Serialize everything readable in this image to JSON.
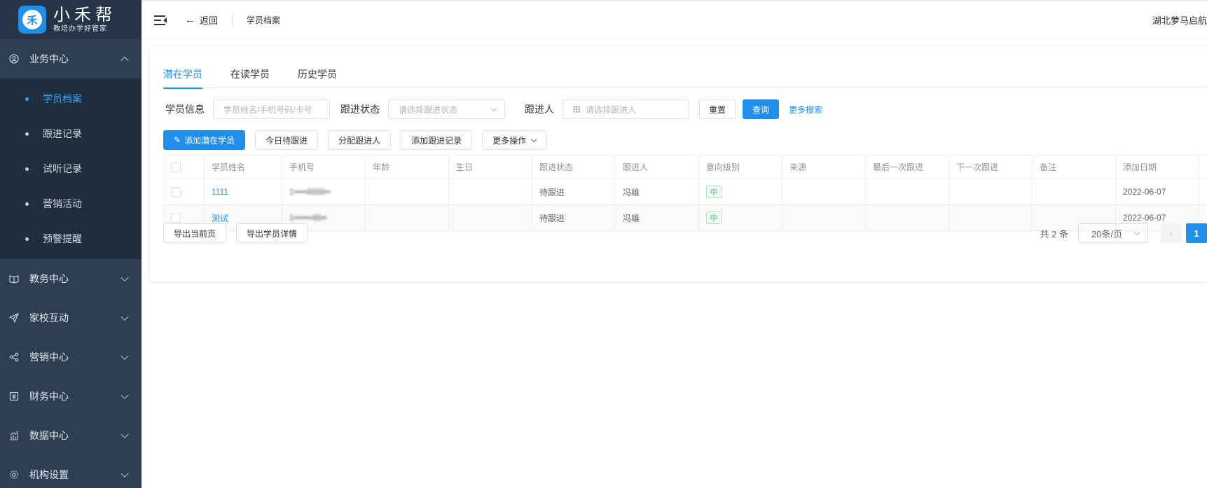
{
  "logo": {
    "main": "小禾帮",
    "sub": "教培办学好管家",
    "badge": "禾"
  },
  "sidebar": {
    "groups": [
      {
        "label": "业务中心",
        "icon": "user-circle-icon",
        "expanded": true,
        "items": [
          {
            "label": "学员档案",
            "active": true
          },
          {
            "label": "跟进记录"
          },
          {
            "label": "试听记录"
          },
          {
            "label": "营销活动"
          },
          {
            "label": "预警提醒"
          }
        ]
      },
      {
        "label": "教务中心",
        "icon": "book-icon"
      },
      {
        "label": "家校互动",
        "icon": "paper-plane-icon"
      },
      {
        "label": "营销中心",
        "icon": "share-icon"
      },
      {
        "label": "财务中心",
        "icon": "finance-icon"
      },
      {
        "label": "数据中心",
        "icon": "chart-icon"
      },
      {
        "label": "机构设置",
        "icon": "gear-icon"
      }
    ]
  },
  "header": {
    "back_label": "返回",
    "breadcrumb": "学员档案",
    "org_name": "湖北萝马启航"
  },
  "tabs": [
    "潜在学员",
    "在读学员",
    "历史学员"
  ],
  "filters": {
    "student_label": "学员信息",
    "student_placeholder": "学员姓名/手机号码/卡号",
    "status_label": "跟进状态",
    "status_placeholder": "请选择跟进状态",
    "follower_label": "跟进人",
    "follower_placeholder": "请选择跟进人",
    "reset": "重置",
    "query": "查询",
    "more_search": "更多搜索"
  },
  "actions": {
    "add_potential": "添加潜在学员",
    "today_follow": "今日待跟进",
    "assign_follower": "分配跟进人",
    "add_record": "添加跟进记录",
    "more_ops": "更多操作"
  },
  "table": {
    "columns": [
      "学员姓名",
      "手机号",
      "年龄",
      "生日",
      "跟进状态",
      "跟进人",
      "意向级别",
      "来源",
      "最后一次跟进",
      "下一次跟进",
      "备注",
      "添加日期"
    ],
    "rows": [
      {
        "name": "1111",
        "phone": "1••••4888••",
        "age": "",
        "birthday": "",
        "status": "待跟进",
        "follower": "冯雄",
        "intent": "中",
        "source": "",
        "last": "",
        "next": "",
        "note": "",
        "date": "2022-06-07"
      },
      {
        "name": "测试",
        "phone": "1••••••46••",
        "age": "",
        "birthday": "",
        "status": "待跟进",
        "follower": "冯雄",
        "intent": "中",
        "source": "",
        "last": "",
        "next": "",
        "note": "",
        "date": "2022-06-07"
      }
    ]
  },
  "footer": {
    "export_page": "导出当前页",
    "export_detail": "导出学员详情",
    "total": "共 2 条",
    "page_size": "20条/页",
    "current_page": "1"
  },
  "colors": {
    "primary": "#1e8fea",
    "sidebar_bg": "#2e3f52",
    "submenu_bg": "#1f2d3d",
    "tag_green": "#4cae6b"
  }
}
